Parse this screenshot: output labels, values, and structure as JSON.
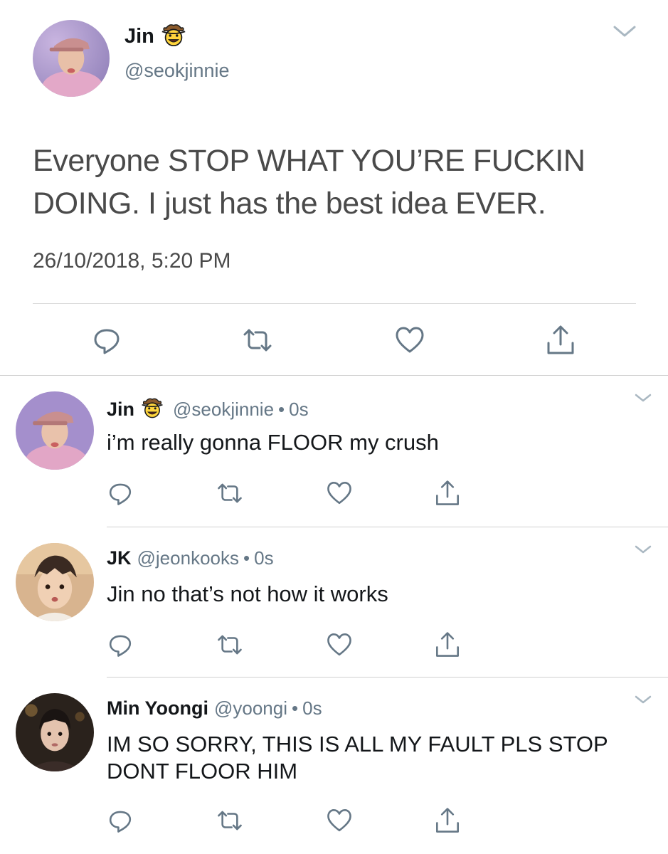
{
  "main_tweet": {
    "author_name": "Jin",
    "author_emoji": "cowboy-hat-face",
    "handle": "@seokjinnie",
    "text": "Everyone STOP WHAT YOU’RE FUCKIN DOING. I just has the best idea EVER.",
    "timestamp": "26/10/2018, 5:20 PM"
  },
  "replies": [
    {
      "author_name": "Jin",
      "emoji": "cowboy-hat-face",
      "handle": "@seokjinnie",
      "dot": "•",
      "time": "0s",
      "text": "i’m really gonna FLOOR my crush"
    },
    {
      "author_name": "JK",
      "handle": "@jeonkooks",
      "dot": "•",
      "time": "0s",
      "text": "Jin no that’s not how it works"
    },
    {
      "author_name": "Min Yoongi",
      "handle": "@yoongi",
      "dot": "•",
      "time": "0s",
      "text": "IM SO SORRY, THIS IS ALL MY FAULT PLS STOP DONT FLOOR HIM"
    }
  ],
  "icons": {
    "actions": [
      "reply-icon",
      "retweet-icon",
      "like-icon",
      "share-icon"
    ],
    "menu": "chevron-down-icon"
  },
  "colors": {
    "text_primary": "#14171a",
    "text_secondary": "#657786",
    "icon": "#657786",
    "divider": "#d0d0d0"
  }
}
